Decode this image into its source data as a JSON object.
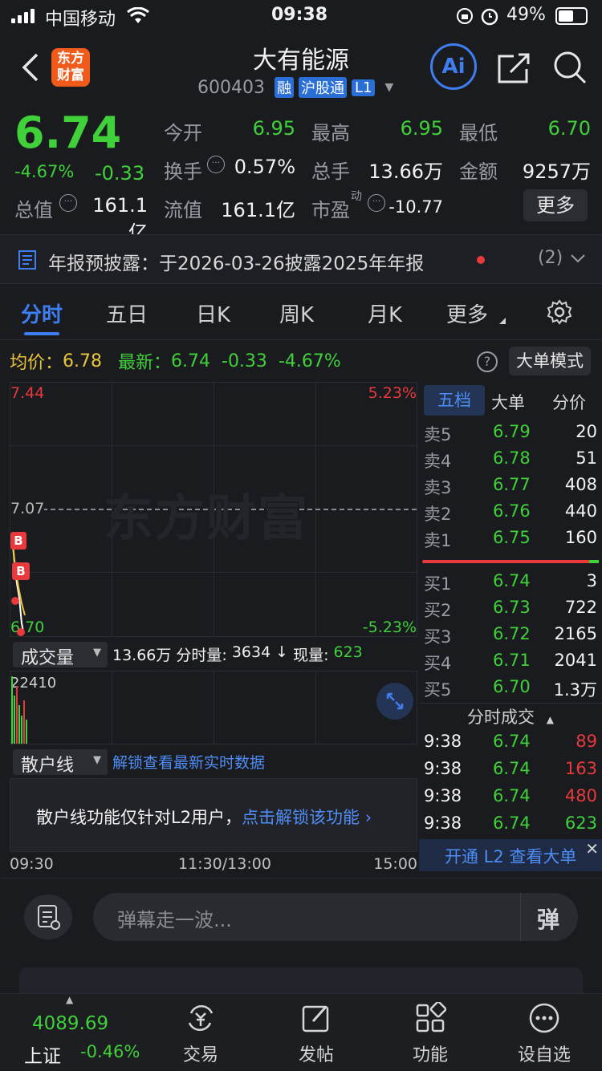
{
  "status": {
    "carrier": "中国移动",
    "time": "09:38",
    "battery": "49%"
  },
  "header": {
    "title": "大有能源",
    "code": "600403",
    "badges": [
      "融",
      "沪股通",
      "L1"
    ]
  },
  "quote": {
    "price": "6.74",
    "pct": "-4.67%",
    "chg": "-0.33",
    "items": [
      {
        "label": "今开",
        "value": "6.95"
      },
      {
        "label": "最高",
        "value": "6.95"
      },
      {
        "label": "最低",
        "value": "6.70"
      },
      {
        "label": "换手",
        "value": "0.57%"
      },
      {
        "label": "总手",
        "value": "13.66万"
      },
      {
        "label": "金额",
        "value": "9257万"
      },
      {
        "label": "总值",
        "value": "161.1亿"
      },
      {
        "label": "流值",
        "value": "161.1亿"
      },
      {
        "label": "市盈",
        "sup": "动",
        "value": "-10.77"
      }
    ],
    "more": "更多"
  },
  "notice": {
    "text": "年报预披露：于2026-03-26披露2025年年报",
    "count": "(2)"
  },
  "tabs": [
    "分时",
    "五日",
    "日K",
    "周K",
    "月K",
    "更多"
  ],
  "summary": {
    "avg_label": "均价：",
    "avg": "6.78",
    "latest_label": "最新：",
    "latest": "6.74",
    "chg": "-0.33",
    "pct": "-4.67%",
    "mode_btn": "大单模式"
  },
  "chart": {
    "ymax": "7.44",
    "ymin": "6.70",
    "ymid": "7.07",
    "pmax": "5.23%",
    "pmin": "-5.23%",
    "watermark": "东方财富",
    "marker": "B"
  },
  "volume": {
    "selector": "成交量",
    "total": "13.66万",
    "period_label": "分时量:",
    "period_val": "3634",
    "now_label": "现量:",
    "now_val": "623",
    "ymax": "22410"
  },
  "retail": {
    "selector": "散户线",
    "unlock_link": "解锁查看最新实时数据",
    "msg": "散户线功能仅针对L2用户，",
    "msg_link": "点击解锁该功能"
  },
  "time_axis": [
    "09:30",
    "11:30/13:00",
    "15:00"
  ],
  "orderbook": {
    "tabs": [
      "五档",
      "大单",
      "分价"
    ],
    "asks": [
      {
        "label": "卖5",
        "price": "6.79",
        "vol": "20"
      },
      {
        "label": "卖4",
        "price": "6.78",
        "vol": "51"
      },
      {
        "label": "卖3",
        "price": "6.77",
        "vol": "408"
      },
      {
        "label": "卖2",
        "price": "6.76",
        "vol": "440"
      },
      {
        "label": "卖1",
        "price": "6.75",
        "vol": "160"
      }
    ],
    "bids": [
      {
        "label": "买1",
        "price": "6.74",
        "vol": "3"
      },
      {
        "label": "买2",
        "price": "6.73",
        "vol": "722"
      },
      {
        "label": "买3",
        "price": "6.72",
        "vol": "2165"
      },
      {
        "label": "买4",
        "price": "6.71",
        "vol": "2041"
      },
      {
        "label": "买5",
        "price": "6.70",
        "vol": "1.3万"
      }
    ],
    "trades_title": "分时成交",
    "trades": [
      {
        "time": "9:38",
        "price": "6.74",
        "vol": "89"
      },
      {
        "time": "9:38",
        "price": "6.74",
        "vol": "163"
      },
      {
        "time": "9:38",
        "price": "6.74",
        "vol": "480"
      },
      {
        "time": "9:38",
        "price": "6.74",
        "vol": "623"
      }
    ],
    "l2_banner": "开通 L2 查看大单"
  },
  "comment": {
    "placeholder": "弹幕走一波...",
    "send": "弹"
  },
  "nav": {
    "index_value": "4089.69",
    "index_name": "上证",
    "index_pct": "-0.46%",
    "items": [
      "交易",
      "发帖",
      "功能",
      "设自选"
    ]
  }
}
